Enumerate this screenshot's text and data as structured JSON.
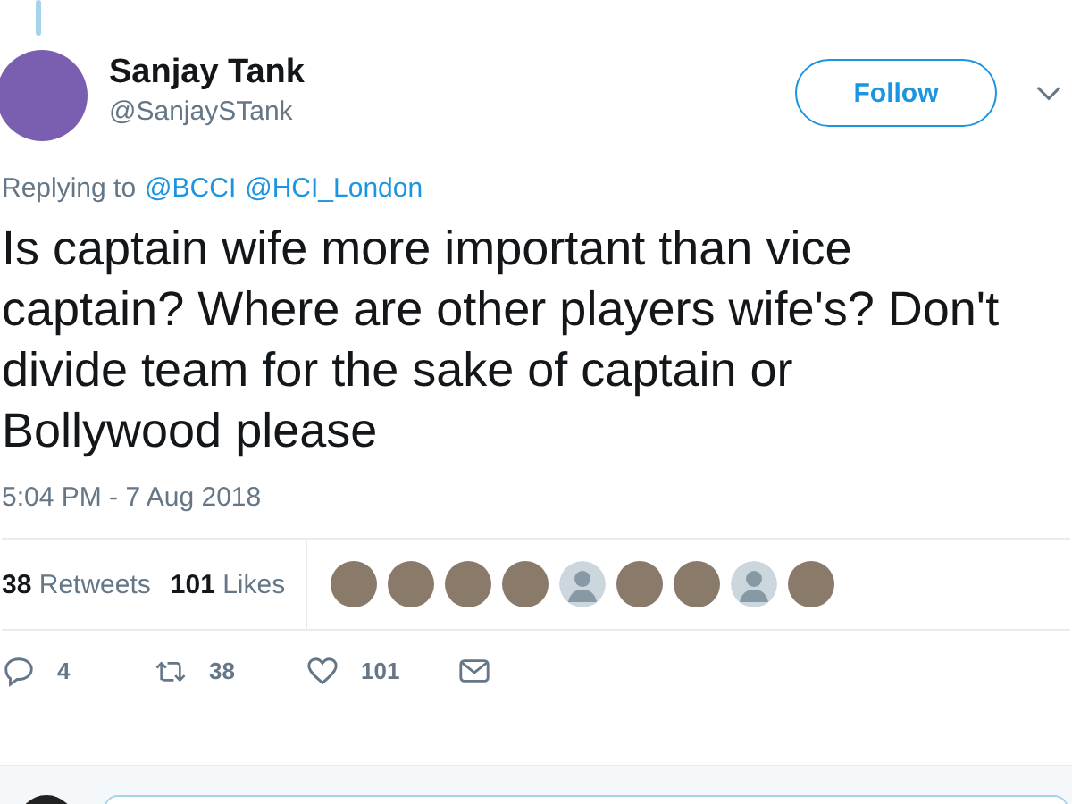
{
  "author": {
    "name": "Sanjay Tank",
    "handle": "@SanjaySTank"
  },
  "follow_button": {
    "label": "Follow"
  },
  "replying": {
    "prefix": "Replying to",
    "mentions": [
      "@BCCI",
      "@HCI_London"
    ]
  },
  "tweet_text": "Is captain wife more important than vice captain? Where are other players wife's? Don't divide team for the sake of captain or Bollywood please",
  "timestamp": "5:04 PM - 7 Aug 2018",
  "stats": [
    {
      "count": "38",
      "label": "Retweets"
    },
    {
      "count": "101",
      "label": "Likes"
    }
  ],
  "likers": [
    {
      "kind": "photo"
    },
    {
      "kind": "photo"
    },
    {
      "kind": "photo"
    },
    {
      "kind": "photo"
    },
    {
      "kind": "default"
    },
    {
      "kind": "photo"
    },
    {
      "kind": "photo"
    },
    {
      "kind": "default"
    },
    {
      "kind": "photo"
    }
  ],
  "actions": [
    {
      "kind": "reply",
      "count": "4"
    },
    {
      "kind": "retweet",
      "count": "38"
    },
    {
      "kind": "like",
      "count": "101"
    },
    {
      "kind": "message"
    }
  ]
}
